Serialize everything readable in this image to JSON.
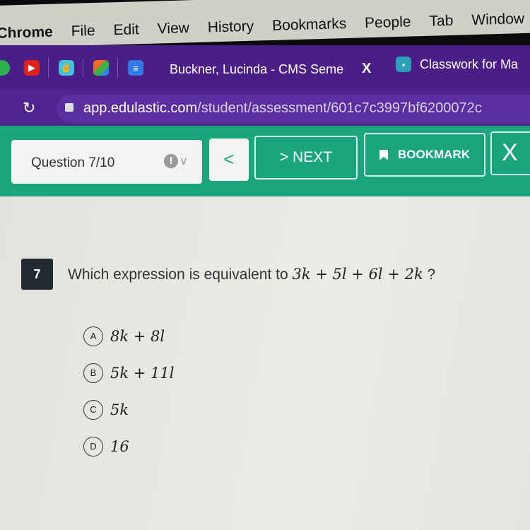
{
  "menubar": {
    "items": [
      "Chrome",
      "File",
      "Edit",
      "View",
      "History",
      "Bookmarks",
      "People",
      "Tab",
      "Window"
    ]
  },
  "tabs": {
    "active_title": "Buckner, Lucinda - CMS Seme",
    "close_label": "X",
    "second_title": "Classwork for Ma"
  },
  "address": {
    "domain": "app.edulastic.com",
    "path": "/student/assessment/601c7c3997bf6200072c"
  },
  "toolbar": {
    "question_select": "Question 7/10",
    "flag_label": "!",
    "prev_label": "<",
    "next_label": "> NEXT",
    "bookmark_label": "BOOKMARK",
    "close_label": "X"
  },
  "question": {
    "number": "7",
    "prompt": "Which expression is equivalent to",
    "expression": "3k + 5l + 6l + 2k",
    "suffix": "?",
    "options": [
      {
        "letter": "A",
        "text": "8k + 8l"
      },
      {
        "letter": "B",
        "text": "5k + 11l"
      },
      {
        "letter": "C",
        "text": "5k"
      },
      {
        "letter": "D",
        "text": "16"
      }
    ]
  }
}
